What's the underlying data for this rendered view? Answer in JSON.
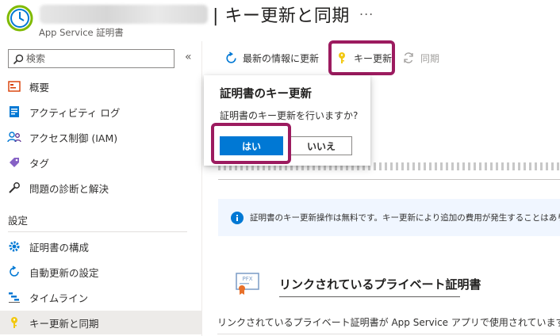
{
  "header": {
    "title": "| キー更新と同期",
    "subtitle": "App Service 証明書",
    "more_label": "..."
  },
  "sidebar": {
    "search_placeholder": "検索",
    "collapse_label": "«",
    "items_top": [
      {
        "label": "概要",
        "icon": "overview-icon"
      },
      {
        "label": "アクティビティ ログ",
        "icon": "activity-log-icon"
      },
      {
        "label": "アクセス制御 (IAM)",
        "icon": "access-control-icon"
      },
      {
        "label": "タグ",
        "icon": "tag-icon"
      },
      {
        "label": "問題の診断と解決",
        "icon": "wrench-icon"
      }
    ],
    "section_label": "設定",
    "items_settings": [
      {
        "label": "証明書の構成",
        "icon": "gear-icon"
      },
      {
        "label": "自動更新の設定",
        "icon": "refresh-icon"
      },
      {
        "label": "タイムライン",
        "icon": "timeline-icon"
      },
      {
        "label": "キー更新と同期",
        "icon": "key-icon",
        "active": true
      }
    ]
  },
  "toolbar": {
    "refresh_label": "最新の情報に更新",
    "rekey_label": "キー更新",
    "sync_label": "同期"
  },
  "dialog": {
    "title": "証明書のキー更新",
    "message": "証明書のキー更新を行いますか?",
    "yes_label": "はい",
    "no_label": "いいえ"
  },
  "info_banner": {
    "text": "証明書のキー更新操作は無料です。キー更新により追加の費用が発生することはあり"
  },
  "linked_section": {
    "icon_text": "PFX",
    "title": "リンクされているプライベート証明書",
    "description": "リンクされているプライベート証明書が App Service アプリで使用されています。キー"
  },
  "colors": {
    "accent": "#0078d4",
    "highlight": "#9c1b5f",
    "key_yellow": "#f2c811",
    "info_bg": "#f0f6ff"
  }
}
